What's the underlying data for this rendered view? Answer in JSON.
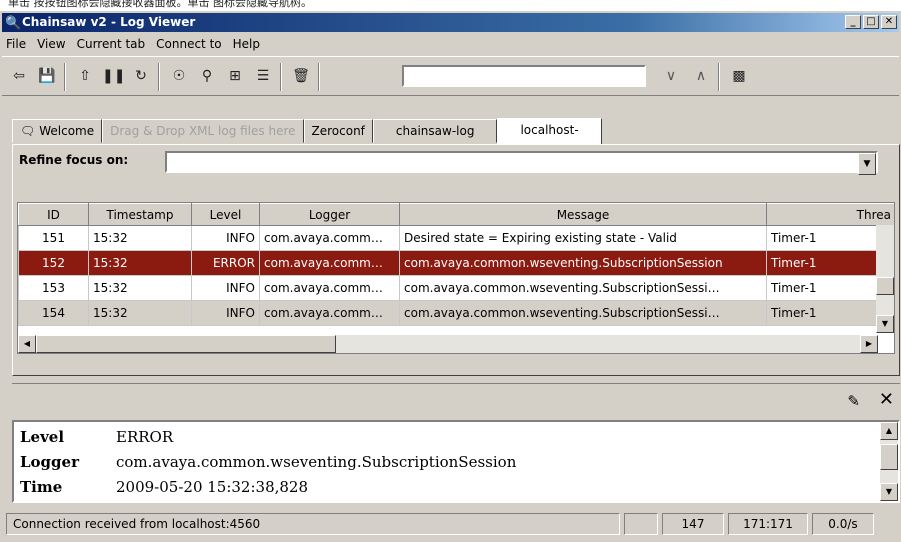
{
  "doc_fragment": "单击 按按钮图标会隐藏接收器面板。单击 图标会隐藏导航树。",
  "window": {
    "title": "Chainsaw v2 - Log Viewer",
    "app_icon": "magnifier-app-icon"
  },
  "menu": [
    {
      "label": "File",
      "mnemonic": "F"
    },
    {
      "label": "View",
      "mnemonic": "V"
    },
    {
      "label": "Current tab"
    },
    {
      "label": "Connect to"
    },
    {
      "label": "Help",
      "mnemonic": "H"
    }
  ],
  "toolbar": {
    "icons": [
      "back-icon",
      "save-icon",
      "scroll-to-top-icon",
      "pause-icon",
      "refresh-icon",
      "clear-focus-icon",
      "find-icon",
      "table-view-icon",
      "detail-pane-icon",
      "delete-icon",
      "find-next-icon",
      "find-previous-icon",
      "toggle-receivers-icon"
    ],
    "find_value": ""
  },
  "tabs": [
    {
      "label": "Welcome",
      "icon": "speech-bubble-icon",
      "state": "normal"
    },
    {
      "label": "Drag & Drop XML log files here",
      "state": "disabled"
    },
    {
      "label": "Zeroconf",
      "state": "normal"
    },
    {
      "label": "chainsaw-log",
      "state": "normal"
    },
    {
      "label": "localhost-",
      "state": "active"
    }
  ],
  "refine": {
    "label": "Refine focus on:",
    "value": ""
  },
  "table": {
    "columns": [
      "ID",
      "Timestamp",
      "Level",
      "Logger",
      "Message",
      "Threa"
    ],
    "rows": [
      {
        "id": "151",
        "timestamp": "15:32",
        "level": "INFO",
        "logger": "com.avaya.comm…",
        "message": "Desired state = Expiring existing state - Valid",
        "thread": "Timer-1",
        "style": "normal"
      },
      {
        "id": "152",
        "timestamp": "15:32",
        "level": "ERROR",
        "logger": "com.avaya.comm…",
        "message": "com.avaya.common.wseventing.SubscriptionSession",
        "thread": "Timer-1",
        "style": "error"
      },
      {
        "id": "153",
        "timestamp": "15:32",
        "level": "INFO",
        "logger": "com.avaya.comm…",
        "message": "com.avaya.common.wseventing.SubscriptionSessi…",
        "thread": "Timer-1",
        "style": "normal"
      },
      {
        "id": "154",
        "timestamp": "15:32",
        "level": "INFO",
        "logger": "com.avaya.comm…",
        "message": "com.avaya.common.wseventing.SubscriptionSessi…",
        "thread": "Timer-1",
        "style": "alt"
      }
    ]
  },
  "detail": {
    "fields": [
      {
        "key": "Level",
        "value": "ERROR"
      },
      {
        "key": "Logger",
        "value": "com.avaya.common.wseventing.SubscriptionSession"
      },
      {
        "key": "Time",
        "value": "2009-05-20 15:32:38,828"
      }
    ]
  },
  "status": {
    "message": "Connection received from localhost:4560",
    "blank": "",
    "count": "147",
    "range": "171:171",
    "rate": "0.0/s"
  },
  "colors": {
    "title_start": "#0a246a",
    "error_row": "#8b1a10",
    "chrome": "#d4d0c8"
  }
}
